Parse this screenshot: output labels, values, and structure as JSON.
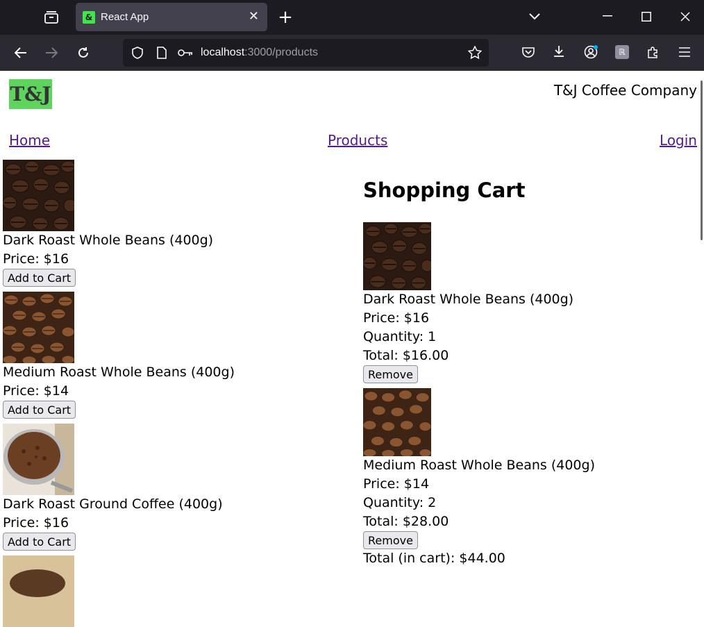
{
  "browser": {
    "tab_title": "React App",
    "favicon_glyph": "&",
    "url_host": "localhost",
    "url_path": ":3000/products"
  },
  "header": {
    "logo_text": "T&J",
    "company": "T&J Coffee Company"
  },
  "nav": {
    "home": "Home",
    "products": "Products",
    "login": "Login"
  },
  "products": [
    {
      "name": "Dark Roast Whole Beans (400g)",
      "price": "Price: $16",
      "button": "Add to Cart"
    },
    {
      "name": "Medium Roast Whole Beans (400g)",
      "price": "Price: $14",
      "button": "Add to Cart"
    },
    {
      "name": "Dark Roast Ground Coffee (400g)",
      "price": "Price: $16",
      "button": "Add to Cart"
    }
  ],
  "cart": {
    "title": "Shopping Cart",
    "items": [
      {
        "name": "Dark Roast Whole Beans (400g)",
        "price": "Price: $16",
        "quantity": "Quantity: 1",
        "total": "Total: $16.00",
        "button": "Remove"
      },
      {
        "name": "Medium Roast Whole Beans (400g)",
        "price": "Price: $14",
        "quantity": "Quantity: 2",
        "total": "Total: $28.00",
        "button": "Remove"
      }
    ],
    "grand_total": "Total (in cart): $44.00"
  },
  "colors": {
    "chrome_dark": "#1c1b22",
    "chrome_toolbar": "#2b2a33",
    "link_visited": "#551a8b",
    "logo_bg": "#5ed35e"
  }
}
